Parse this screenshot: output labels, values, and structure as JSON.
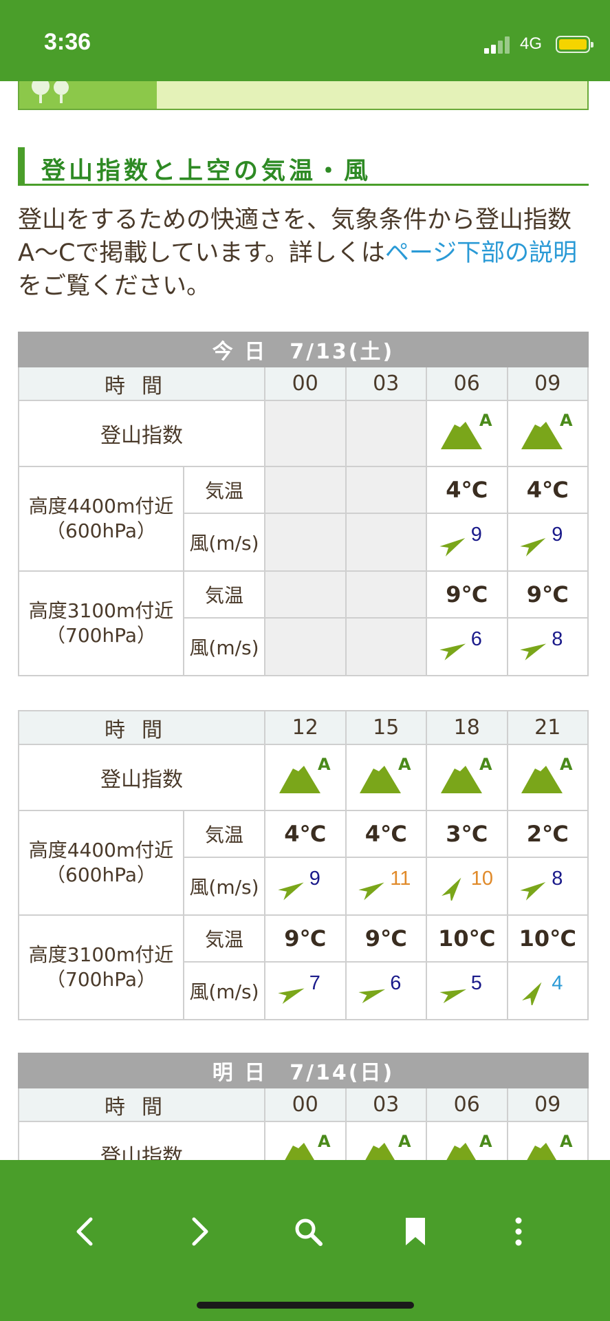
{
  "status_bar": {
    "time": "3:36",
    "network": "4G",
    "battery_color": "#f5d400"
  },
  "section": {
    "title": "登山指数と上空の気温・風",
    "intro_before": "登山をするための快適さを、気象条件から登山指数A〜Cで掲載しています。詳しくは",
    "intro_link": "ページ下部の説明",
    "intro_after": "をご覧ください。"
  },
  "labels": {
    "time": "時間",
    "index": "登山指数",
    "alt_4400_line1": "高度4400m付近",
    "alt_4400_line2": "（600hPa）",
    "alt_3100_line1": "高度3100m付近",
    "alt_3100_line2": "（700hPa）",
    "temp": "気温",
    "wind": "風(m/s)"
  },
  "table1": {
    "date": "今 日　7/13(土)",
    "hours": [
      "00",
      "03",
      "06",
      "09"
    ],
    "index": [
      "",
      "",
      "A",
      "A"
    ],
    "t4400": [
      "",
      "",
      "4℃",
      "4℃"
    ],
    "w4400": [
      {
        "speed": "",
        "dir": 0,
        "color": ""
      },
      {
        "speed": "",
        "dir": 0,
        "color": ""
      },
      {
        "speed": "9",
        "dir": 60,
        "color": "#1a1a8a"
      },
      {
        "speed": "9",
        "dir": 60,
        "color": "#1a1a8a"
      }
    ],
    "t3100": [
      "",
      "",
      "9℃",
      "9℃"
    ],
    "w3100": [
      {
        "speed": "",
        "dir": 0,
        "color": ""
      },
      {
        "speed": "",
        "dir": 0,
        "color": ""
      },
      {
        "speed": "6",
        "dir": 65,
        "color": "#1a1a8a"
      },
      {
        "speed": "8",
        "dir": 65,
        "color": "#1a1a8a"
      }
    ]
  },
  "table2": {
    "hours": [
      "12",
      "15",
      "18",
      "21"
    ],
    "index": [
      "A",
      "A",
      "A",
      "A"
    ],
    "t4400": [
      "4℃",
      "4℃",
      "3℃",
      "2℃"
    ],
    "w4400": [
      {
        "speed": "9",
        "dir": 62,
        "color": "#1a1a8a"
      },
      {
        "speed": "11",
        "dir": 62,
        "color": "#e08a2a"
      },
      {
        "speed": "10",
        "dir": 35,
        "color": "#e08a2a"
      },
      {
        "speed": "8",
        "dir": 60,
        "color": "#1a1a8a"
      }
    ],
    "t3100": [
      "9℃",
      "9℃",
      "10℃",
      "10℃"
    ],
    "w3100": [
      {
        "speed": "7",
        "dir": 68,
        "color": "#1a1a8a"
      },
      {
        "speed": "6",
        "dir": 72,
        "color": "#1a1a8a"
      },
      {
        "speed": "5",
        "dir": 72,
        "color": "#1a1a8a"
      },
      {
        "speed": "4",
        "dir": 35,
        "color": "#2a9ad6"
      }
    ]
  },
  "table3": {
    "date": "明 日　7/14(日)",
    "hours": [
      "00",
      "03",
      "06",
      "09"
    ],
    "index": [
      "A",
      "A",
      "A",
      "A"
    ]
  },
  "colors": {
    "brand_green": "#4a9e2a",
    "mountain": "#7aa61a",
    "index_letter": "#4a8a1a",
    "link": "#2a9ad6"
  }
}
